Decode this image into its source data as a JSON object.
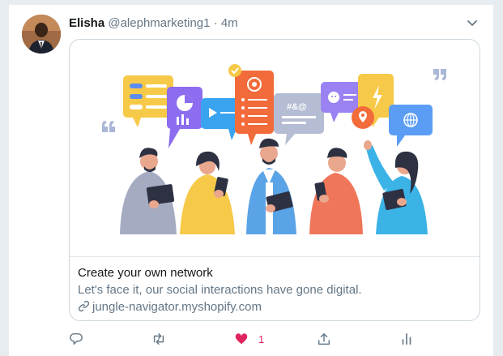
{
  "tweet": {
    "display_name": "Elisha",
    "handle": "@alephmarketing1",
    "separator": "·",
    "time": "4m"
  },
  "card": {
    "title": "Create your own network",
    "description": "Let's face it, our social interactions have gone digital.",
    "domain": "jungle-navigator.myshopify.com",
    "illustration_icons": [
      "toggle-list-bubble",
      "pie-chart-bubble",
      "video-play-bubble",
      "settings-form-bubble",
      "symbol-bubble",
      "emoji-bubble",
      "location-pin-icon",
      "lightning-bubble",
      "globe-bubble",
      "quote-icon",
      "checkmark-icon"
    ]
  },
  "actions": {
    "reply_icon": "reply-icon",
    "retweet_icon": "retweet-icon",
    "like_icon": "heart-icon",
    "like_count": "1",
    "share_icon": "share-icon",
    "analytics_icon": "analytics-icon"
  },
  "colors": {
    "like_active": "#e0245e",
    "text_primary": "#14171a",
    "text_secondary": "#657786",
    "border": "#ccd6dd"
  }
}
